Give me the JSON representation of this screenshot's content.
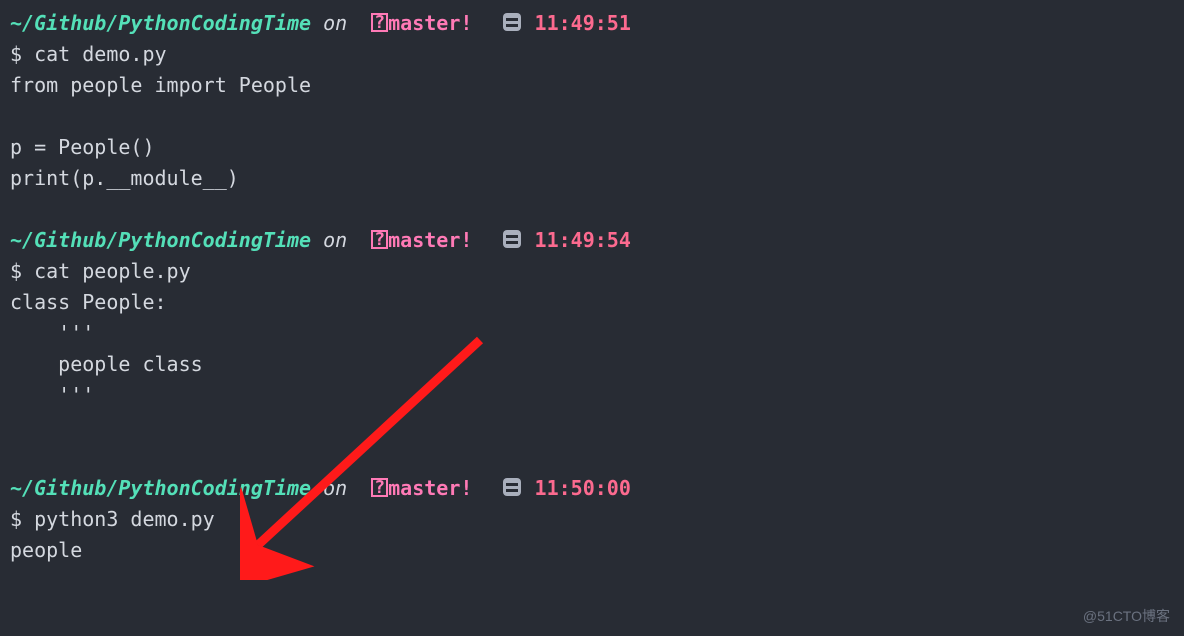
{
  "blocks": [
    {
      "prompt": {
        "path": "~/Github/PythonCodingTime",
        "on": "on",
        "branch_q": "?",
        "branch": "master!",
        "time": "11:49:51"
      },
      "cmd_sym": "$",
      "cmd": "cat demo.py",
      "output": [
        "from people import People",
        "",
        "p = People()",
        "print(p.__module__)"
      ]
    },
    {
      "prompt": {
        "path": "~/Github/PythonCodingTime",
        "on": "on",
        "branch_q": "?",
        "branch": "master!",
        "time": "11:49:54"
      },
      "cmd_sym": "$",
      "cmd": "cat people.py",
      "output": [
        "class People:",
        "    '''",
        "    people class",
        "    '''",
        ""
      ]
    },
    {
      "prompt": {
        "path": "~/Github/PythonCodingTime",
        "on": "on",
        "branch_q": "?",
        "branch": "master!",
        "time": "11:50:00"
      },
      "cmd_sym": "$",
      "cmd": "python3 demo.py",
      "output": [
        "people"
      ]
    }
  ],
  "watermark": "@51CTO博客"
}
